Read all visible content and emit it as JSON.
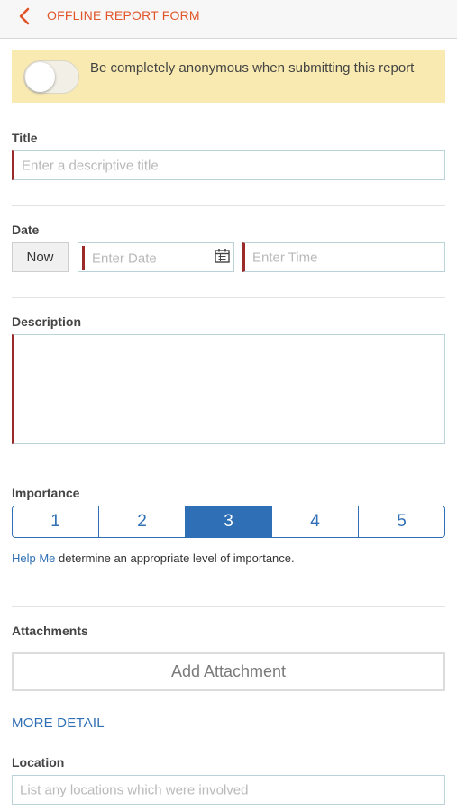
{
  "header": {
    "title": "OFFLINE REPORT FORM",
    "back_icon": "chevron-left-icon",
    "accent": "#e0562a"
  },
  "anonymous": {
    "text": "Be completely anonymous when submitting this report",
    "enabled": false,
    "background": "#f8eab0"
  },
  "title_field": {
    "label": "Title",
    "placeholder": "Enter a descriptive title",
    "value": ""
  },
  "date_field": {
    "label": "Date",
    "now_label": "Now",
    "date_placeholder": "Enter Date",
    "time_placeholder": "Enter Time",
    "calendar_icon": "calendar-icon"
  },
  "description_field": {
    "label": "Description",
    "value": ""
  },
  "importance": {
    "label": "Importance",
    "options": [
      "1",
      "2",
      "3",
      "4",
      "5"
    ],
    "selected": "3",
    "help_link": "Help Me",
    "help_text": " determine an appropriate level of importance.",
    "accent": "#2f6fb5"
  },
  "attachments": {
    "label": "Attachments",
    "button_label": "Add Attachment"
  },
  "more_detail": {
    "label": "MORE DETAIL"
  },
  "location_field": {
    "label": "Location",
    "placeholder": "List any locations which were involved"
  }
}
